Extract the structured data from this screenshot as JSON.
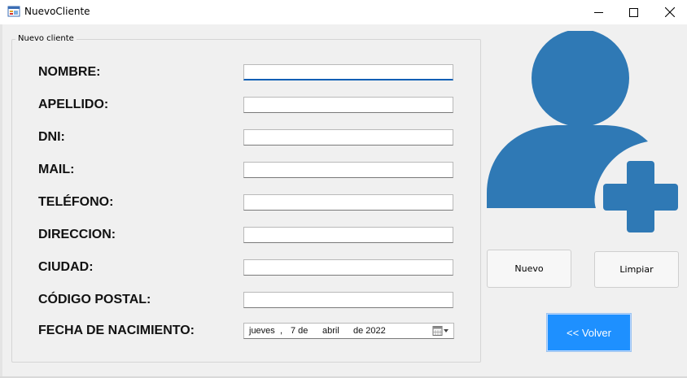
{
  "window": {
    "title": "NuevoCliente"
  },
  "group": {
    "legend": "Nuevo cliente"
  },
  "fields": [
    {
      "label": "NOMBRE:",
      "value": ""
    },
    {
      "label": "APELLIDO:",
      "value": ""
    },
    {
      "label": "DNI:",
      "value": ""
    },
    {
      "label": "MAIL:",
      "value": ""
    },
    {
      "label": "TELÉFONO:",
      "value": ""
    },
    {
      "label": "DIRECCION:",
      "value": ""
    },
    {
      "label": "CIUDAD:",
      "value": ""
    },
    {
      "label": "CÓDIGO POSTAL:",
      "value": ""
    }
  ],
  "birthdate": {
    "label": "FECHA DE NACIMIENTO:",
    "weekday": "jueves",
    "sep": ",",
    "day": "7 de",
    "month": "abril",
    "year": "de 2022"
  },
  "buttons": {
    "new": "Nuevo",
    "clear": "Limpiar",
    "back": "<< Volver"
  },
  "icons": {
    "illustration": "add-user-icon",
    "app": "form-icon"
  },
  "colors": {
    "accent": "#2f79b5",
    "back_button": "#1e90ff",
    "focus": "#0a5fb4"
  }
}
